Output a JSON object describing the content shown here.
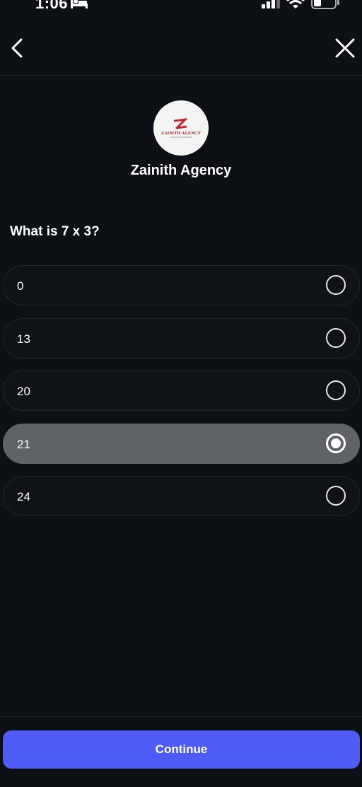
{
  "status_bar": {
    "time": "1:06",
    "icons": [
      "bed-icon",
      "signal-icon",
      "wifi-icon",
      "battery-icon"
    ]
  },
  "nav": {
    "back_icon": "chevron-left-icon",
    "close_icon": "close-icon"
  },
  "brand": {
    "logo_text": "ZAINITH AGENCY",
    "logo_subtext": "YOUR TRUSTED PARTNER",
    "name": "Zainith Agency"
  },
  "quiz": {
    "question": "What is 7 x 3?",
    "options": [
      {
        "label": "0",
        "selected": false
      },
      {
        "label": "13",
        "selected": false
      },
      {
        "label": "20",
        "selected": false
      },
      {
        "label": "21",
        "selected": true
      },
      {
        "label": "24",
        "selected": false
      }
    ]
  },
  "footer": {
    "continue_label": "Continue"
  },
  "colors": {
    "background": "#0d1014",
    "selected_option": "#5f6368",
    "accent": "#4f5bf5",
    "brand_red": "#c0272d"
  }
}
